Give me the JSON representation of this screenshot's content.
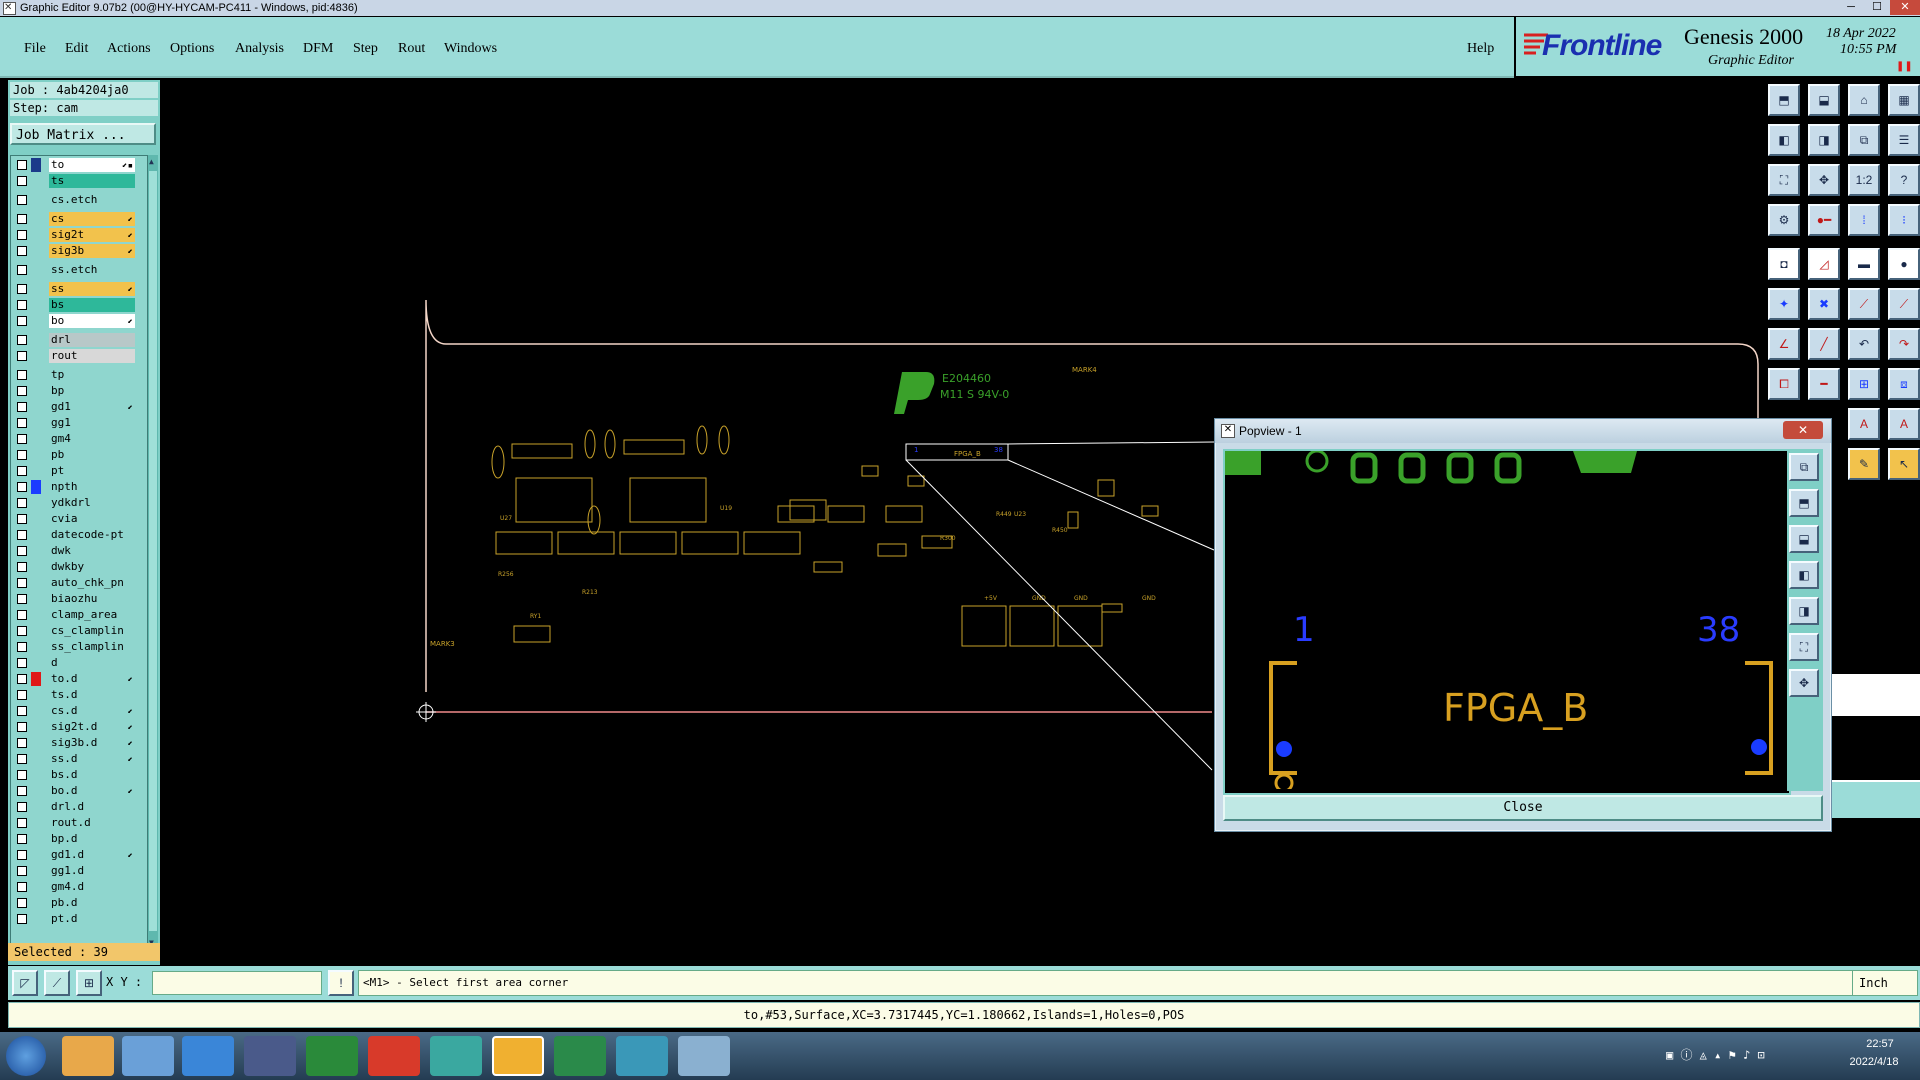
{
  "window": {
    "title": "Graphic Editor 9.07b2 (00@HY-HYCAM-PC411 - Windows, pid:4836)"
  },
  "menu": {
    "file": "File",
    "edit": "Edit",
    "actions": "Actions",
    "options": "Options",
    "analysis": "Analysis",
    "dfm": "DFM",
    "step": "Step",
    "rout": "Rout",
    "windows": "Windows",
    "help": "Help"
  },
  "brand": {
    "logo": "Frontline",
    "product": "Genesis 2000",
    "subtitle": "Graphic Editor",
    "date": "18 Apr 2022",
    "time": "10:55 PM"
  },
  "left": {
    "job": "Job : 4ab4204ja0",
    "step": "Step: cam",
    "job_matrix": "Job Matrix ...",
    "selected": "Selected : 39"
  },
  "layers": [
    {
      "name": "to",
      "bg": "#ffffff",
      "mark": "#1b3a8a",
      "flag": "⬋▪"
    },
    {
      "name": "ts",
      "bg": "#2eb89a",
      "mark": "",
      "flag": ""
    },
    {
      "name": "cs.etch",
      "bg": "#8fd6ce",
      "mark": "",
      "flag": ""
    },
    {
      "name": "cs",
      "bg": "#f2c24c",
      "mark": "",
      "flag": "⬋"
    },
    {
      "name": "sig2t",
      "bg": "#f2c24c",
      "mark": "",
      "flag": "⬋"
    },
    {
      "name": "sig3b",
      "bg": "#f2c24c",
      "mark": "",
      "flag": "⬋"
    },
    {
      "name": "ss.etch",
      "bg": "#8fd6ce",
      "mark": "",
      "flag": ""
    },
    {
      "name": "ss",
      "bg": "#f2c24c",
      "mark": "",
      "flag": "⬋"
    },
    {
      "name": "bs",
      "bg": "#2eb89a",
      "mark": "",
      "flag": ""
    },
    {
      "name": "bo",
      "bg": "#ffffff",
      "mark": "",
      "flag": "⬋"
    },
    {
      "name": "drl",
      "bg": "#b8c8c8",
      "mark": "",
      "flag": ""
    },
    {
      "name": "rout",
      "bg": "#d8d8d8",
      "mark": "",
      "flag": ""
    },
    {
      "name": "tp",
      "bg": "#8fd6ce",
      "mark": "",
      "flag": ""
    },
    {
      "name": "bp",
      "bg": "#8fd6ce",
      "mark": "",
      "flag": ""
    },
    {
      "name": "gd1",
      "bg": "#8fd6ce",
      "mark": "",
      "flag": "⬋"
    },
    {
      "name": "gg1",
      "bg": "#8fd6ce",
      "mark": "",
      "flag": ""
    },
    {
      "name": "gm4",
      "bg": "#8fd6ce",
      "mark": "",
      "flag": ""
    },
    {
      "name": "pb",
      "bg": "#8fd6ce",
      "mark": "",
      "flag": ""
    },
    {
      "name": "pt",
      "bg": "#8fd6ce",
      "mark": "",
      "flag": ""
    },
    {
      "name": "npth",
      "bg": "#8fd6ce",
      "mark": "#1a3cff",
      "flag": ""
    },
    {
      "name": "ydkdrl",
      "bg": "#8fd6ce",
      "mark": "",
      "flag": ""
    },
    {
      "name": "cvia",
      "bg": "#8fd6ce",
      "mark": "",
      "flag": ""
    },
    {
      "name": "datecode-pt",
      "bg": "#8fd6ce",
      "mark": "",
      "flag": ""
    },
    {
      "name": "dwk",
      "bg": "#8fd6ce",
      "mark": "",
      "flag": ""
    },
    {
      "name": "dwkby",
      "bg": "#8fd6ce",
      "mark": "",
      "flag": ""
    },
    {
      "name": "auto_chk_pn",
      "bg": "#8fd6ce",
      "mark": "",
      "flag": ""
    },
    {
      "name": "biaozhu",
      "bg": "#8fd6ce",
      "mark": "",
      "flag": ""
    },
    {
      "name": "clamp_area",
      "bg": "#8fd6ce",
      "mark": "",
      "flag": ""
    },
    {
      "name": "cs_clamplin",
      "bg": "#8fd6ce",
      "mark": "",
      "flag": ""
    },
    {
      "name": "ss_clamplin",
      "bg": "#8fd6ce",
      "mark": "",
      "flag": ""
    },
    {
      "name": "d",
      "bg": "#8fd6ce",
      "mark": "",
      "flag": ""
    },
    {
      "name": "to.d",
      "bg": "#8fd6ce",
      "mark": "#e01818",
      "flag": "⬋"
    },
    {
      "name": "ts.d",
      "bg": "#8fd6ce",
      "mark": "",
      "flag": ""
    },
    {
      "name": "cs.d",
      "bg": "#8fd6ce",
      "mark": "",
      "flag": "⬋"
    },
    {
      "name": "sig2t.d",
      "bg": "#8fd6ce",
      "mark": "",
      "flag": "⬋"
    },
    {
      "name": "sig3b.d",
      "bg": "#8fd6ce",
      "mark": "",
      "flag": "⬋"
    },
    {
      "name": "ss.d",
      "bg": "#8fd6ce",
      "mark": "",
      "flag": "⬋"
    },
    {
      "name": "bs.d",
      "bg": "#8fd6ce",
      "mark": "",
      "flag": ""
    },
    {
      "name": "bo.d",
      "bg": "#8fd6ce",
      "mark": "",
      "flag": "⬋"
    },
    {
      "name": "drl.d",
      "bg": "#8fd6ce",
      "mark": "",
      "flag": ""
    },
    {
      "name": "rout.d",
      "bg": "#8fd6ce",
      "mark": "",
      "flag": ""
    },
    {
      "name": "bp.d",
      "bg": "#8fd6ce",
      "mark": "",
      "flag": ""
    },
    {
      "name": "gd1.d",
      "bg": "#8fd6ce",
      "mark": "",
      "flag": "⬋"
    },
    {
      "name": "gg1.d",
      "bg": "#8fd6ce",
      "mark": "",
      "flag": ""
    },
    {
      "name": "gm4.d",
      "bg": "#8fd6ce",
      "mark": "",
      "flag": ""
    },
    {
      "name": "pb.d",
      "bg": "#8fd6ce",
      "mark": "",
      "flag": ""
    },
    {
      "name": "pt.d",
      "bg": "#8fd6ce",
      "mark": "",
      "flag": ""
    }
  ],
  "board": {
    "ul_text": "E204460",
    "ul_sub": "M11 S 94V-0",
    "mark_top": "MARK4",
    "mark_left": "MARK3",
    "fpga_small": "FPGA_B",
    "gnd": "GND",
    "v5": "+5V"
  },
  "popview": {
    "title": "Popview - 1",
    "pin1": "1",
    "pin38": "38",
    "label": "FPGA_B",
    "close": "Close"
  },
  "cmd": {
    "xy_label": "X Y :",
    "xy_value": "",
    "prompt": "<M1> - Select first area corner",
    "units": "Inch"
  },
  "status": {
    "text": "to,#53,Surface,XC=3.7317445,YC=1.180662,Islands=1,Holes=0,POS"
  },
  "taskbar": {
    "time": "22:57",
    "date": "2022/4/18"
  },
  "colors": {
    "silk": "#c8a22a",
    "green": "#3aa12a",
    "blue": "#2a3cff",
    "outline": "#f4d6c8",
    "red": "#e01818"
  }
}
